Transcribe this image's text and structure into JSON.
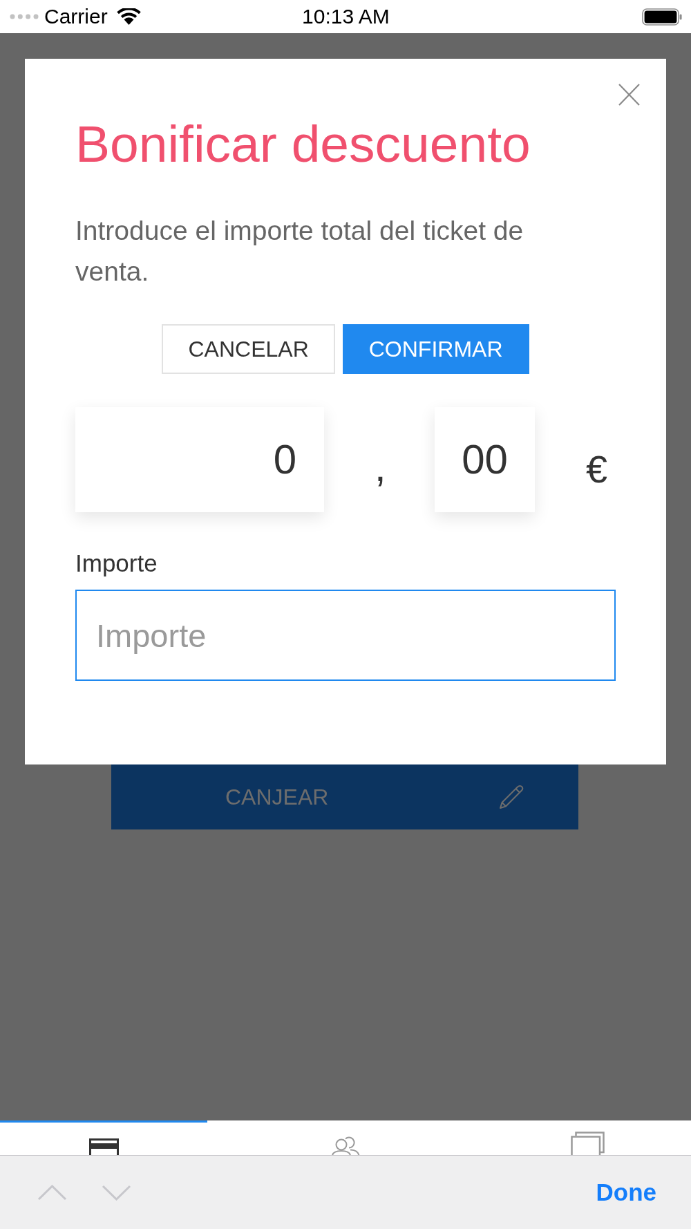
{
  "status_bar": {
    "carrier": "Carrier",
    "time": "10:13 AM"
  },
  "dialog": {
    "title": "Bonificar descuento",
    "message": "Introduce el importe total del ticket de venta.",
    "buttons": [
      {
        "label": "CANCELAR",
        "kind": "secondary"
      },
      {
        "label": "CONFIRMAR",
        "kind": "primary"
      }
    ],
    "amount": {
      "integer": "0",
      "separator": ",",
      "decimals": "00",
      "currency": "€"
    },
    "field": {
      "label": "Importe",
      "placeholder": "Importe",
      "focused": true
    }
  },
  "background": {
    "button": {
      "label": "CANJEAR"
    }
  },
  "tab_bar": {
    "tabs": [
      {
        "selected": true
      },
      {
        "selected": false
      },
      {
        "selected": false
      }
    ]
  },
  "keyboard_toolbar": {
    "arrows": [
      {
        "kind": "up",
        "disabled": true
      },
      {
        "kind": "down",
        "disabled": true
      }
    ],
    "done": "Done"
  }
}
